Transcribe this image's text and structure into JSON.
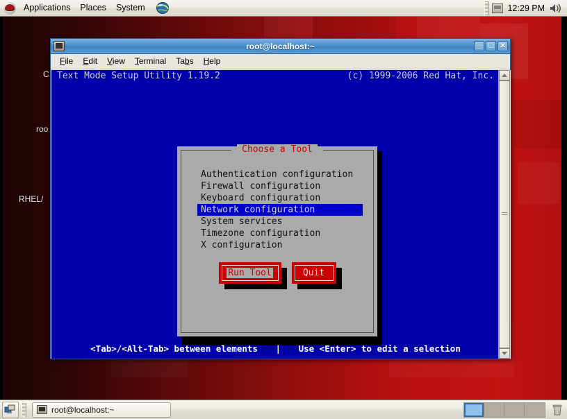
{
  "top_panel": {
    "logo_icon": "redhat-logo-icon",
    "menus": [
      "Applications",
      "Places",
      "System"
    ],
    "launcher_icon": "globe-browser-icon",
    "tray_icon": "display-applet-icon",
    "clock": "12:29 PM",
    "volume_icon": "speaker-icon"
  },
  "desktop": {
    "icon_labels": [
      "C",
      "roo",
      "RHEL/"
    ]
  },
  "terminal_window": {
    "title": "root@localhost:~",
    "window_icon": "terminal-icon",
    "buttons": {
      "minimize": "_",
      "maximize": "□",
      "close": "✕"
    },
    "menubar": [
      {
        "label": "File",
        "mnemonic": "F"
      },
      {
        "label": "Edit",
        "mnemonic": "E"
      },
      {
        "label": "View",
        "mnemonic": "V"
      },
      {
        "label": "Terminal",
        "mnemonic": "T"
      },
      {
        "label": "Tabs",
        "mnemonic": "b"
      },
      {
        "label": "Help",
        "mnemonic": "H"
      }
    ]
  },
  "tui": {
    "header_left": "Text Mode Setup Utility 1.19.2",
    "header_right": "(c) 1999-2006 Red Hat, Inc.",
    "footer_left": "<Tab>/<Alt-Tab> between elements",
    "footer_sep": "|",
    "footer_right": "Use <Enter> to edit a selection",
    "dialog": {
      "title": "Choose a Tool",
      "items": [
        "Authentication configuration",
        "Firewall configuration",
        "Keyboard configuration",
        "Network configuration",
        "System services",
        "Timezone configuration",
        "X configuration"
      ],
      "selected_index": 3,
      "buttons": [
        {
          "label": "Run Tool",
          "focused": true
        },
        {
          "label": "Quit",
          "focused": false
        }
      ]
    }
  },
  "bottom_panel": {
    "show_desktop_icon": "show-desktop-icon",
    "tasks": [
      {
        "label": "root@localhost:~",
        "icon": "terminal-icon",
        "active": true
      }
    ],
    "workspaces": [
      {
        "active": true
      },
      {
        "active": false
      },
      {
        "active": false
      },
      {
        "active": false
      }
    ],
    "trash_icon": "trash-icon"
  },
  "colors": {
    "tui_background": "#0000aa",
    "tui_dialog": "#aaaaaa",
    "tui_selection": "#0000cc",
    "tui_accent_red": "#cc0000",
    "titlebar_blue": "#4f93cd",
    "desktop_red": "#8f0d0d"
  }
}
